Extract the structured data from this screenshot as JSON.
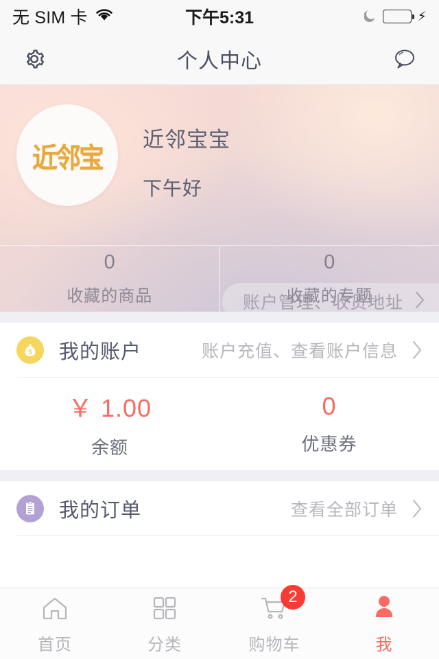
{
  "status_bar": {
    "carrier": "无 SIM 卡",
    "wifi_icon": "wifi-icon",
    "time": "下午5:31",
    "moon_icon": "moon-icon",
    "battery_icon": "battery-icon",
    "charging_icon": "charging-bolt-icon",
    "battery_color": "#4CD964"
  },
  "nav_bar": {
    "settings_icon": "gear-icon",
    "title": "个人中心",
    "message_icon": "chat-bubble-icon"
  },
  "profile": {
    "avatar_icon": "avatar",
    "avatar_logo_text": "近邻宝",
    "username": "近邻宝宝",
    "greeting": "下午好",
    "account_link_label": "账户管理、收货地址",
    "chevron_icon": "chevron-right-icon",
    "stats": [
      {
        "value": "0",
        "label": "收藏的商品"
      },
      {
        "value": "0",
        "label": "收藏的专题"
      }
    ]
  },
  "account_section": {
    "icon": "money-bag-icon",
    "icon_color": "#F6D75E",
    "title": "我的账户",
    "subtitle": "账户充值、查看账户信息",
    "chevron_icon": "chevron-right-icon",
    "metrics": [
      {
        "value": "￥ 1.00",
        "label": "余额",
        "color": "#F96B62"
      },
      {
        "value": "0",
        "label": "优惠券",
        "color": "#F96B62"
      }
    ]
  },
  "orders_section": {
    "icon": "clipboard-icon",
    "icon_color": "#B3A1D4",
    "title": "我的订单",
    "subtitle": "查看全部订单",
    "chevron_icon": "chevron-right-icon"
  },
  "tab_bar": {
    "active_color": "#FA6B64",
    "badge_color": "#F93B34",
    "tabs": [
      {
        "label": "首页",
        "icon": "home-icon",
        "active": false
      },
      {
        "label": "分类",
        "icon": "grid-icon",
        "active": false
      },
      {
        "label": "购物车",
        "icon": "shopping-cart-icon",
        "active": false,
        "badge": "2"
      },
      {
        "label": "我",
        "icon": "person-icon",
        "active": true
      }
    ]
  }
}
